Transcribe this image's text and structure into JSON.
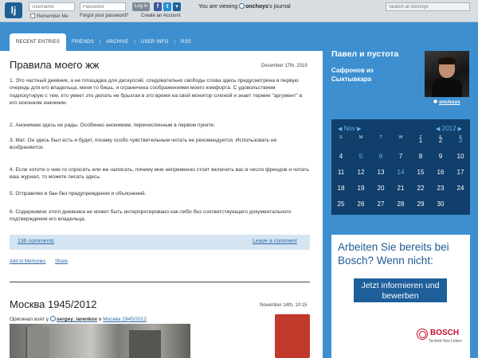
{
  "topbar": {
    "logo_label": "lj",
    "username_placeholder": "Username",
    "password_placeholder": "Password",
    "login_label": "Log in",
    "remember_label": "Remember Me",
    "forgot_label": "Forgot your password?",
    "create_label": "Create an Account",
    "viewing_prefix": "You are viewing",
    "viewing_user": "onchoys",
    "viewing_suffix": "'s journal",
    "search_placeholder": "Search at onchoys",
    "social": [
      {
        "icon": "facebook-icon",
        "glyph": "f",
        "color": "#3b5998"
      },
      {
        "icon": "twitter-icon",
        "glyph": "t",
        "color": "#2a8ed6"
      },
      {
        "icon": "dropdown-icon",
        "glyph": "▾",
        "color": "#1f5f95"
      }
    ]
  },
  "tabs": [
    "RECENT ENTRIES",
    "FRIENDS",
    "ARCHIVE",
    "USER INFO",
    "RSS"
  ],
  "entry1": {
    "title": "Правила моего жж",
    "date": "December 17th, 2019",
    "paragraphs": [
      "1. Это частный дневник, а не площадка для дискуссий, следовательно свободы слова здесь предусмотрена в первую очередь для его владельца, меня то бишь, и ограничена соображениями моего комфорта. С удовольствием подискутирую с тем, кто умеет это делать не брызгая в это время на свой монитор слюной и знает термин \"аргумент\" в его исконном значении.",
      "2. Анонимам здесь не рады. Особенно анонимам, перечисленным в первом пункте.",
      "3. Мат. Он здесь был есть и будет, посему особо чувствительным читать не рекомендуется. Использовать не возбраняется.",
      "4. Если хотите о чем-то спросить или же написать, почему мне непременно стоит включить вас в число френдов и читать ваш журнал, то можете писать здесь.",
      "5. Отправляю в бан без предупреждения и объяснений.",
      "6. Содержимое этого дневника не может быть интерпретировано как-либо без соответствующего документального подтверждения его владельца."
    ],
    "comments_label": "136 comments",
    "leave_comment_label": "Leave a comment",
    "add_memories_label": "Add to Memories",
    "share_label": "Share"
  },
  "entry2": {
    "title": "Москва 1945/2012",
    "date": "November 14th, 10:15",
    "orig_prefix": "Оригинал взят у",
    "orig_user": "sergey_larenkov",
    "orig_mid": "в",
    "orig_link": "Москва 1945/2012"
  },
  "sidebar": {
    "journal_title": "Павел и пустота",
    "journal_subtitle": "Сафронов из Сыктывкара",
    "userpic_name": "onchoys"
  },
  "calendar": {
    "month": "Nov",
    "year": "2012",
    "dow": [
      "S",
      "M",
      "T",
      "W",
      "T",
      "F",
      "S"
    ],
    "weeks": [
      [
        "",
        "",
        "",
        "",
        "1",
        "2",
        "3"
      ],
      [
        "4",
        "5",
        "6",
        "7",
        "8",
        "9",
        "10"
      ],
      [
        "11",
        "12",
        "13",
        "14",
        "15",
        "16",
        "17"
      ],
      [
        "18",
        "19",
        "20",
        "21",
        "22",
        "23",
        "24"
      ],
      [
        "25",
        "26",
        "27",
        "28",
        "29",
        "30",
        ""
      ]
    ],
    "linked_days": [
      "3",
      "5",
      "6",
      "14"
    ]
  },
  "ad": {
    "headline": "Arbeiten Sie bereits bei Bosch? Wenn nicht:",
    "button_label": "Jetzt informieren und bewerben",
    "brand": "BOSCH",
    "tagline": "Technik fürs Leben"
  }
}
